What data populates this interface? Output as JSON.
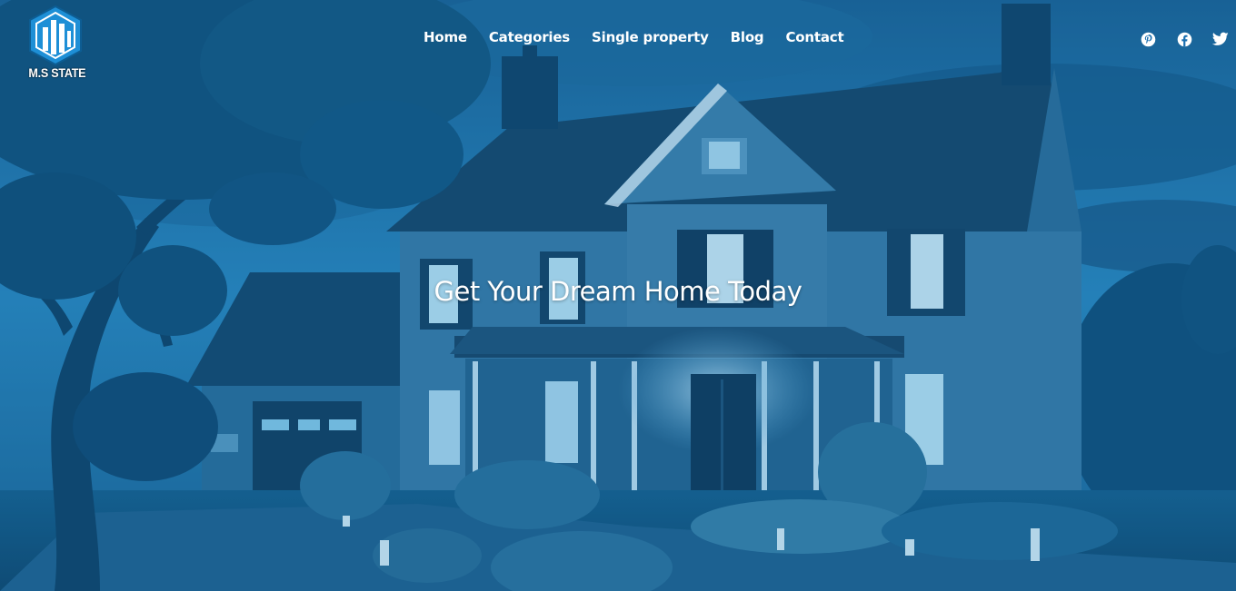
{
  "brand": {
    "name": "M.S STATE",
    "logo_icon": "building-hexagon-logo",
    "color_primary": "#1e8fd6"
  },
  "nav": {
    "items": [
      {
        "label": "Home"
      },
      {
        "label": "Categories"
      },
      {
        "label": "Single property"
      },
      {
        "label": "Blog"
      },
      {
        "label": "Contact"
      }
    ]
  },
  "social": {
    "icons": [
      "pinterest-icon",
      "facebook-icon",
      "twitter-icon"
    ]
  },
  "hero": {
    "headline": "Get Your Dream Home Today",
    "background": "house-at-dusk-photo",
    "tint_color": "#1a6fb0"
  }
}
